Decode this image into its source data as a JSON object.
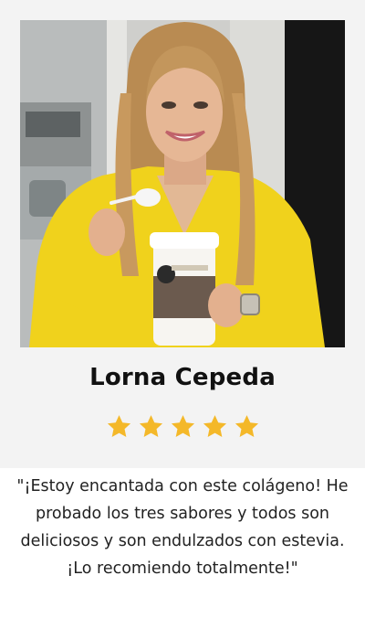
{
  "testimonial": {
    "name": "Lorna Cepeda",
    "rating": 5,
    "rating_max": 5,
    "quote": "\"¡Estoy encantada con este colágeno! He probado los tres sabores y todos son deliciosos y son endulzados con estevia. ¡Lo recomiendo totalmente!\"",
    "photo_icon": "person-holding-collagen-jar-photo"
  },
  "colors": {
    "card_background": "#f3f3f3",
    "star": "#f4b829",
    "name_text": "#111111",
    "quote_text": "#222222"
  }
}
